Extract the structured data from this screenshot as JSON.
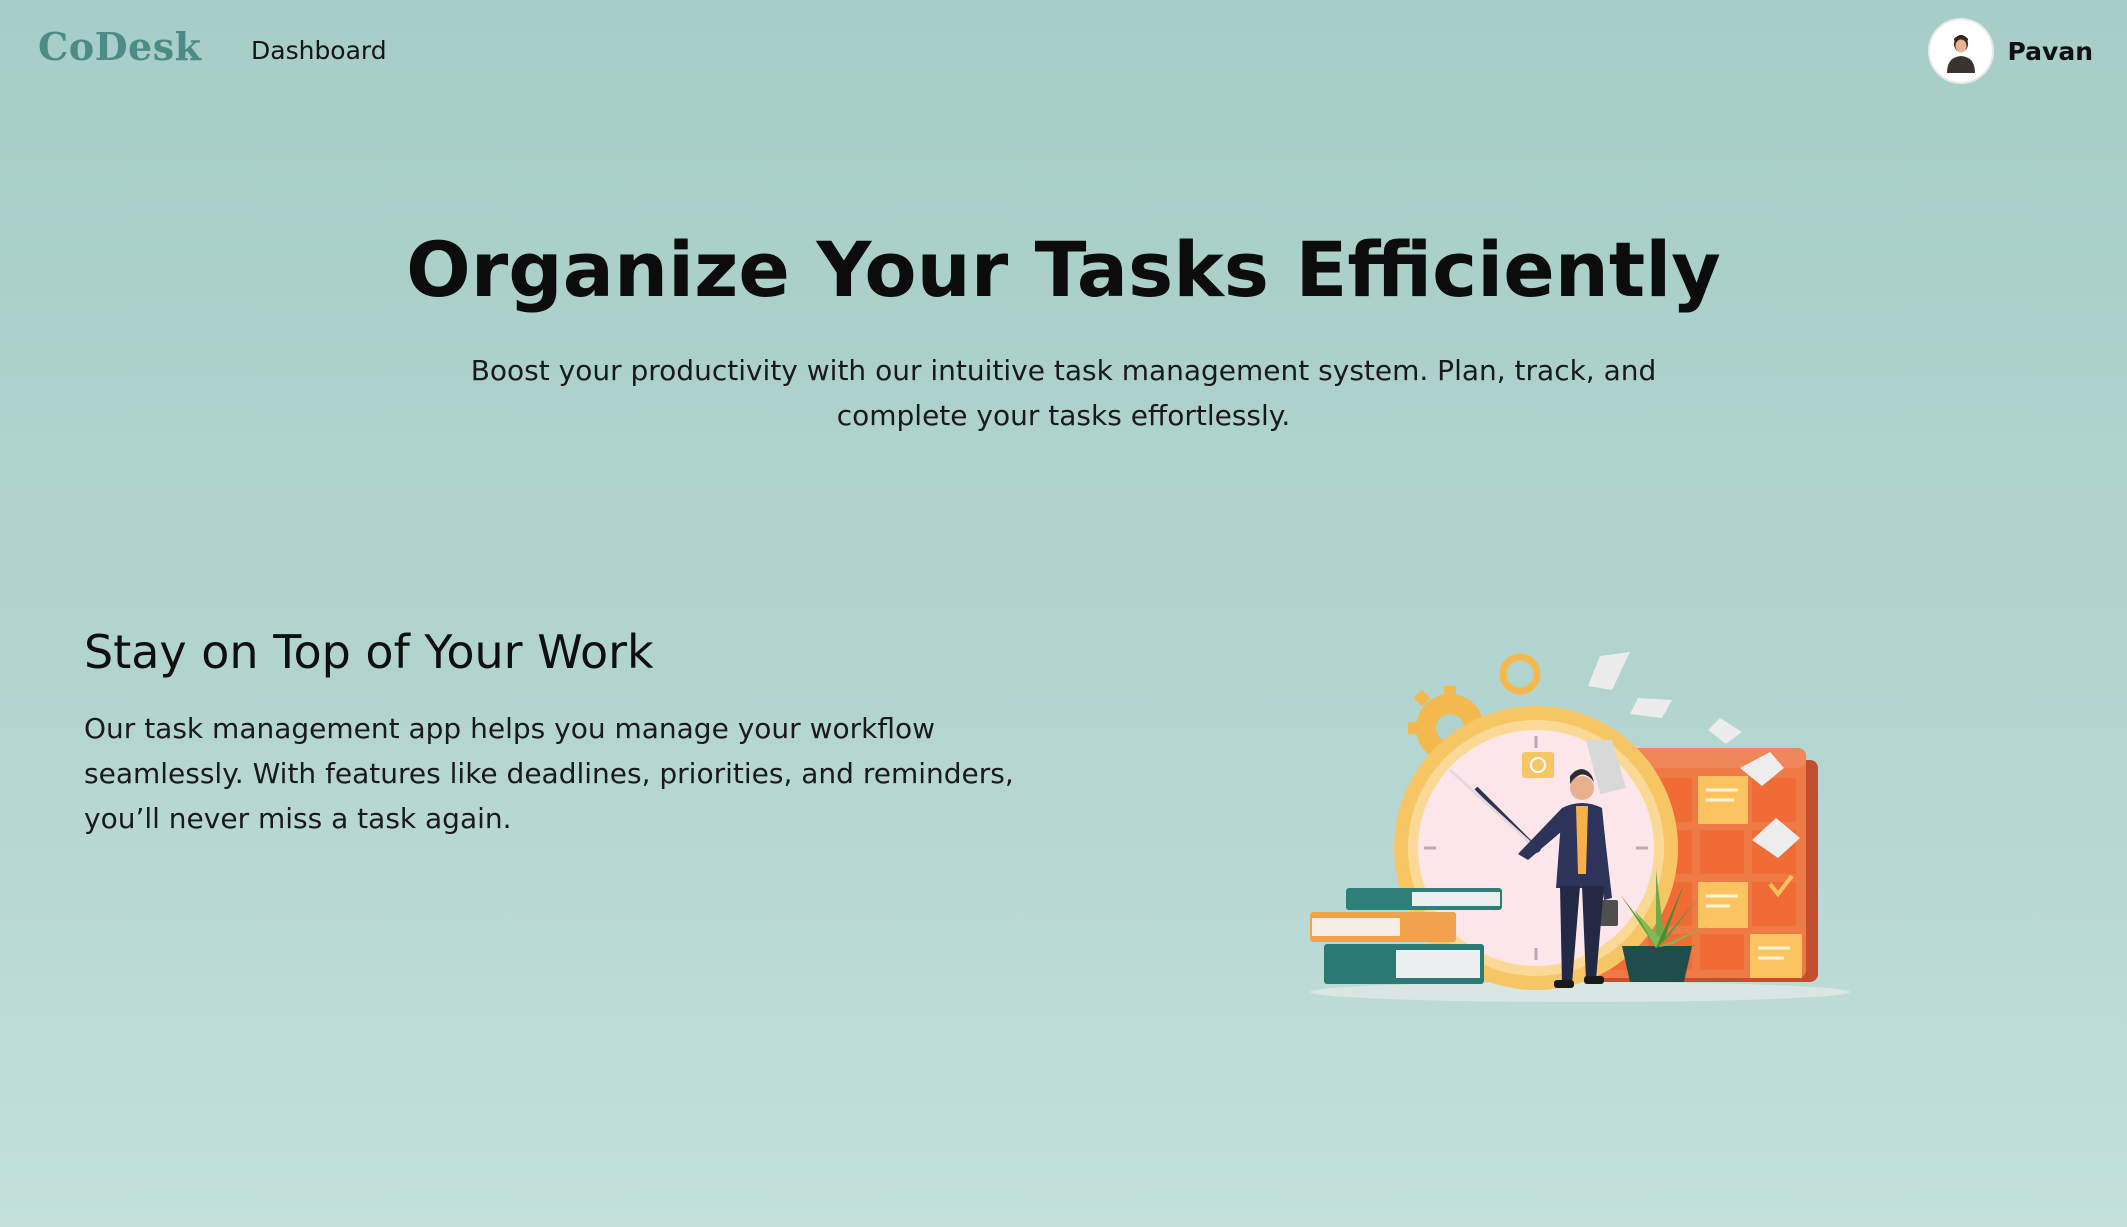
{
  "header": {
    "logo": "CoDesk",
    "nav": [
      {
        "label": "Dashboard"
      }
    ],
    "user": {
      "name": "Pavan"
    }
  },
  "hero": {
    "title": "Organize Your Tasks Efficiently",
    "subtitle": "Boost your productivity with our intuitive task management system. Plan, track, and complete your tasks effortlessly."
  },
  "feature": {
    "title": "Stay on Top of Your Work",
    "text": "Our task management app helps you manage your workflow seamlessly. With features like deadlines, priorities, and reminders, you’ll never miss a task again."
  },
  "colors": {
    "background_top": "#a6cdc7",
    "background_bottom": "#c3e0db",
    "logo": "#4d8b86",
    "calendar_orange": "#ee7a45",
    "sticky_note": "#fcc361",
    "clock_ring": "#f6c564"
  },
  "icons": {
    "avatar": "user-avatar-icon",
    "illustration": "task-management-illustration"
  }
}
